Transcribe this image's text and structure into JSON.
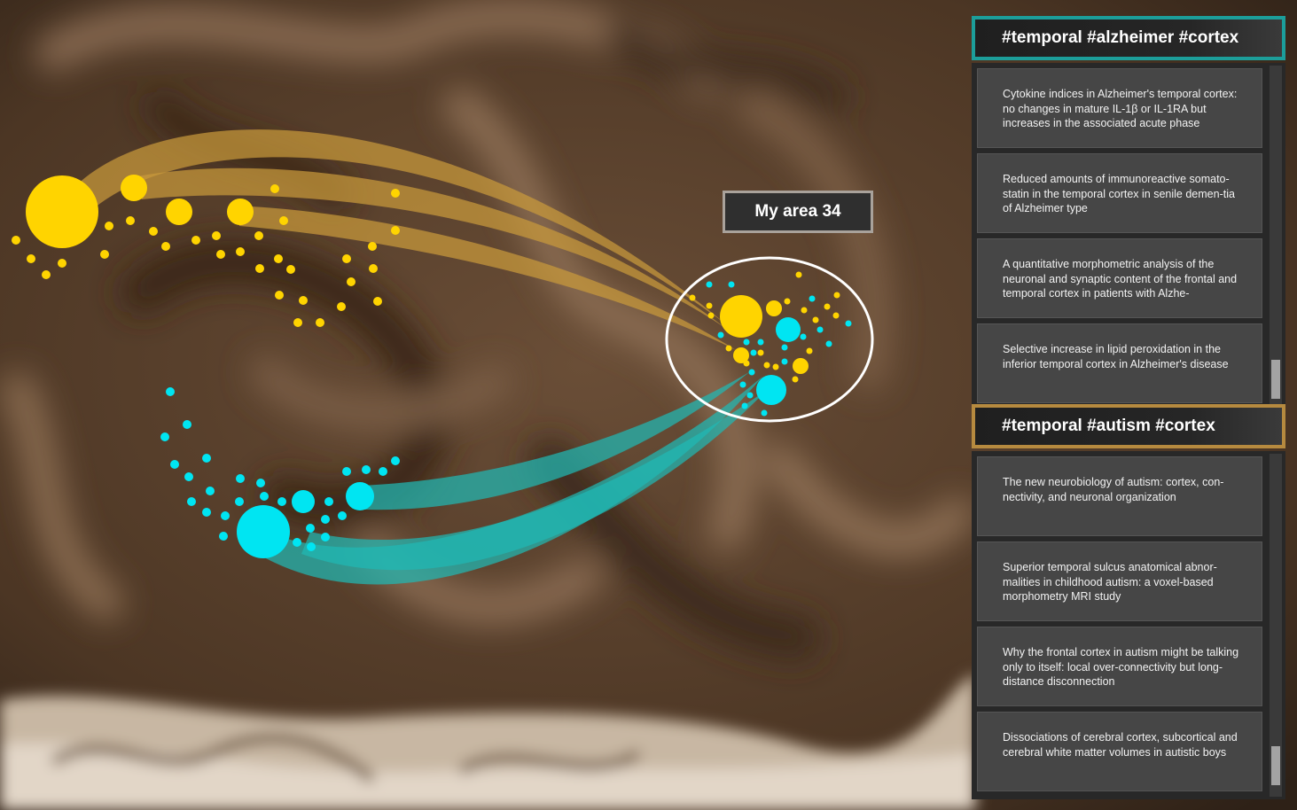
{
  "area_label": "My area 34",
  "colors": {
    "yellow": "#ffd400",
    "cyan": "#00e5f2",
    "teal_border": "#1c9e9a",
    "gold_border": "#b68a3f",
    "yellow_stream": "#c99a3c",
    "cyan_stream": "#20b8b4"
  },
  "panels": [
    {
      "header": "#temporal #alzheimer #cortex",
      "items": [
        "Cytokine indices in Alzheimer's temporal cortex: no changes in mature IL-1β or IL-1RA but increases in the associated acute phase",
        "Reduced amounts of immunoreactive somato-statin in the temporal cortex in senile demen-tia of Alzheimer type",
        "A quantitative morphometric analysis of the neuronal and synaptic content of the frontal and temporal cortex in patients with Alzhe-",
        "Selective increase in lipid peroxidation in the inferior temporal cortex in Alzheimer's disease"
      ]
    },
    {
      "header": "#temporal #autism #cortex",
      "items": [
        " The new neurobiology of autism: cortex, con-nectivity, and neuronal organization",
        "Superior temporal sulcus anatomical abnor-malities in childhood autism: a voxel-based morphometry MRI study",
        "Why the frontal cortex in autism might be talking only to itself: local over-connectivity but long-distance disconnection",
        "Dissociations of cerebral cortex, subcortical and cerebral white matter volumes in autistic boys"
      ]
    }
  ]
}
